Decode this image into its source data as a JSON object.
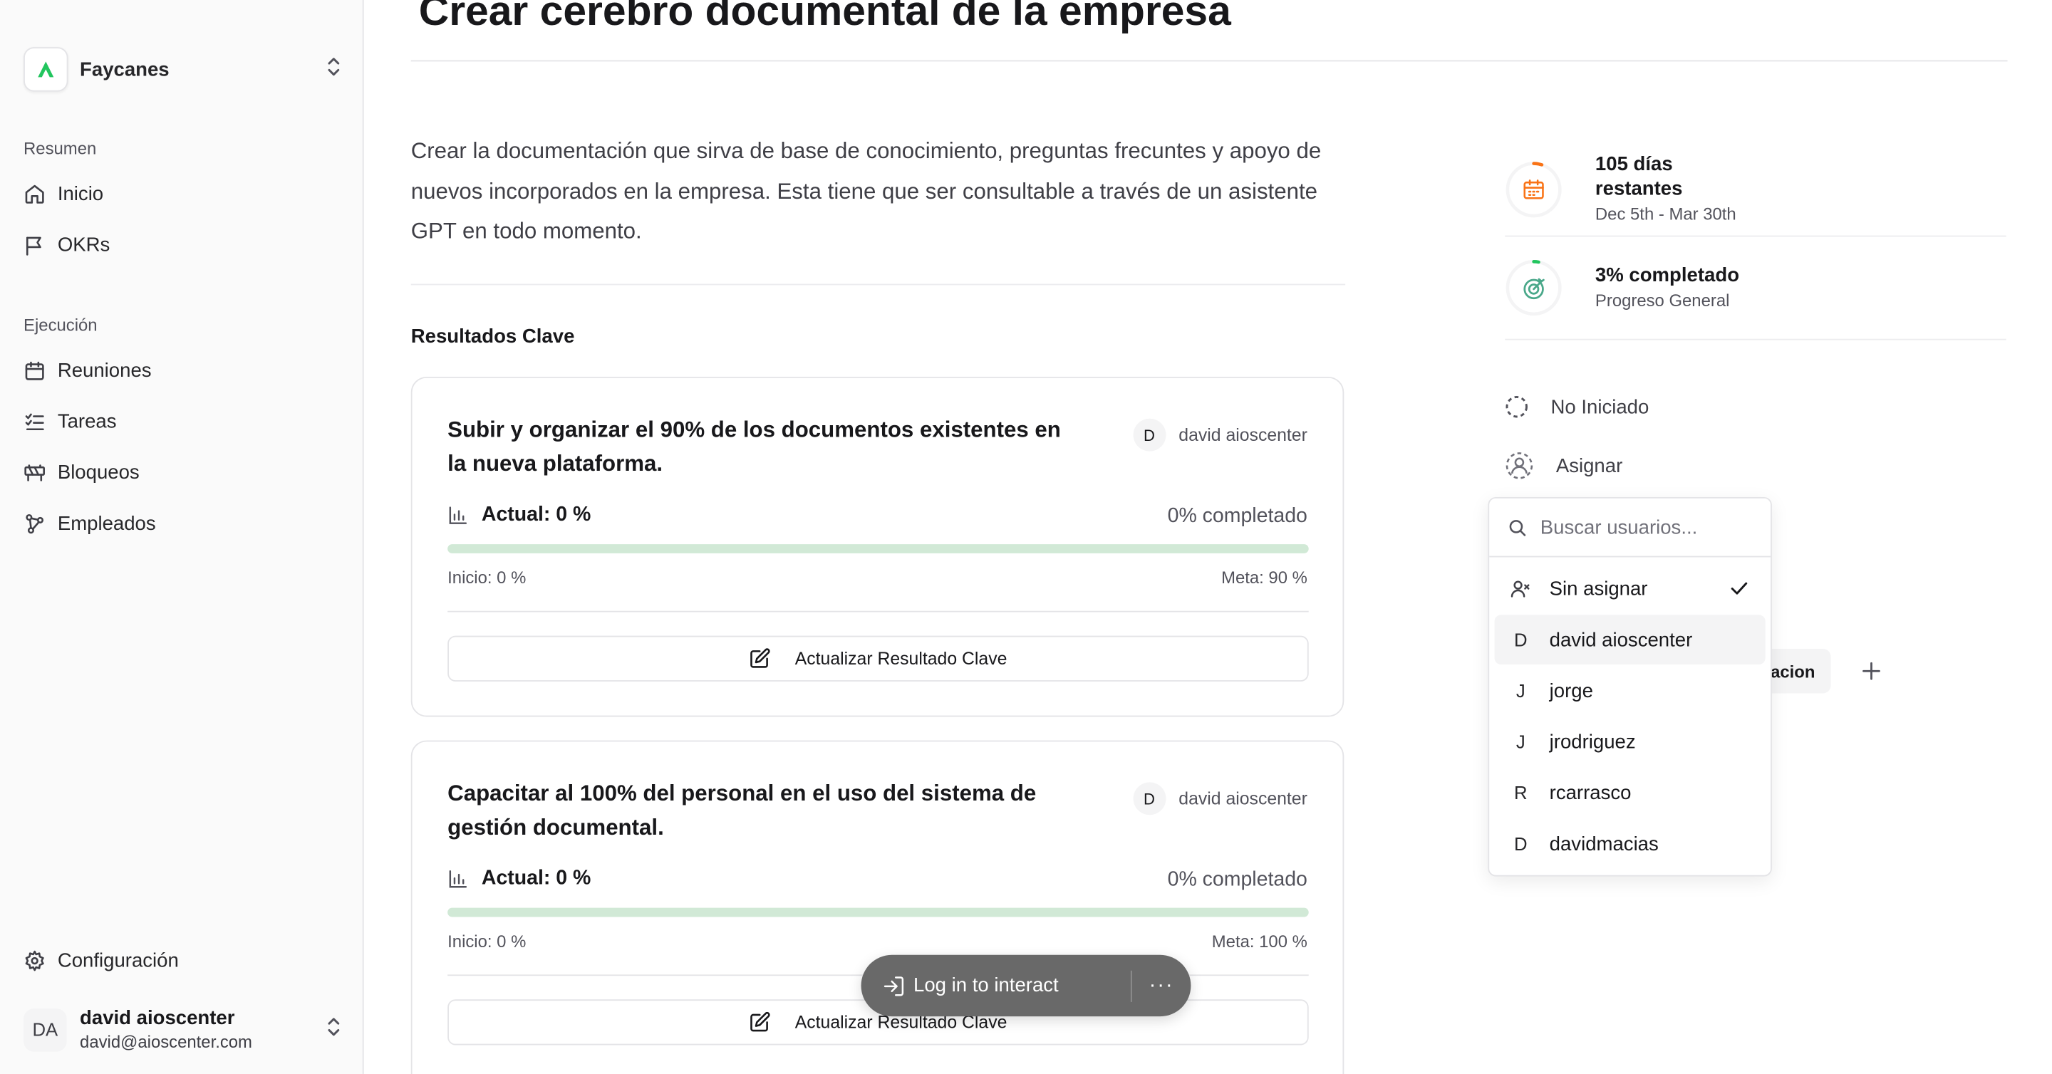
{
  "app": {
    "workspace_name": "Faycanes",
    "accent_color": "#22c55e"
  },
  "sidebar": {
    "sections": [
      {
        "label": "Resumen",
        "items": [
          {
            "label": "Inicio",
            "icon": "home-icon"
          },
          {
            "label": "OKRs",
            "icon": "flag-icon"
          }
        ]
      },
      {
        "label": "Ejecución",
        "items": [
          {
            "label": "Reuniones",
            "icon": "calendar-icon"
          },
          {
            "label": "Tareas",
            "icon": "list-checks-icon"
          },
          {
            "label": "Bloqueos",
            "icon": "construction-barrier-icon"
          },
          {
            "label": "Empleados",
            "icon": "network-icon"
          }
        ]
      }
    ],
    "settings_label": "Configuración",
    "user": {
      "initials": "DA",
      "name": "david aioscenter",
      "email": "david@aioscenter.com"
    }
  },
  "objective": {
    "title": "Crear cerebro documental de la empresa",
    "description": "Crear la documentación que sirva de base de conocimiento, preguntas frecuntes y apoyo de nuevos incorporados en la empresa. Esta tiene que ser consultable a través de un asistente GPT en todo momento."
  },
  "key_results": {
    "heading": "Resultados Clave",
    "items": [
      {
        "title": "Subir y organizar el 90% de los documentos existentes en la nueva plataforma.",
        "owner_initial": "D",
        "owner_name": "david aioscenter",
        "actual": "Actual: 0 %",
        "completion": "0% completado",
        "progress_fraction": 0,
        "start": "Inicio: 0 %",
        "goal": "Meta: 90 %",
        "button_label": "Actualizar Resultado Clave"
      },
      {
        "title": "Capacitar al 100% del personal en el uso del sistema de gestión documental.",
        "owner_initial": "D",
        "owner_name": "david aioscenter",
        "actual": "Actual: 0 %",
        "completion": "0% completado",
        "progress_fraction": 0,
        "start": "Inicio: 0 %",
        "goal": "Meta: 100 %",
        "button_label": "Actualizar Resultado Clave"
      }
    ]
  },
  "panel": {
    "days": {
      "main": "105 días restantes",
      "sub": "Dec 5th - Mar 30th",
      "ring_fraction": 0.05,
      "ring_color": "#f97316"
    },
    "progress": {
      "main": "3% completado",
      "sub": "Progreso General",
      "ring_fraction": 0.03,
      "ring_color": "#22c55e"
    },
    "status_label": "No Iniciado",
    "assign_label": "Asignar",
    "partial_chip_text": "acion"
  },
  "assign_dropdown": {
    "search_placeholder": "Buscar usuarios...",
    "unassigned_label": "Sin asignar",
    "users": [
      {
        "initial": "D",
        "name": "david aioscenter"
      },
      {
        "initial": "J",
        "name": "jorge"
      },
      {
        "initial": "J",
        "name": "jrodriguez"
      },
      {
        "initial": "R",
        "name": "rcarrasco"
      },
      {
        "initial": "D",
        "name": "davidmacias"
      }
    ]
  },
  "floating_bar": {
    "login_label": "Log in to interact",
    "more_label": "···"
  }
}
